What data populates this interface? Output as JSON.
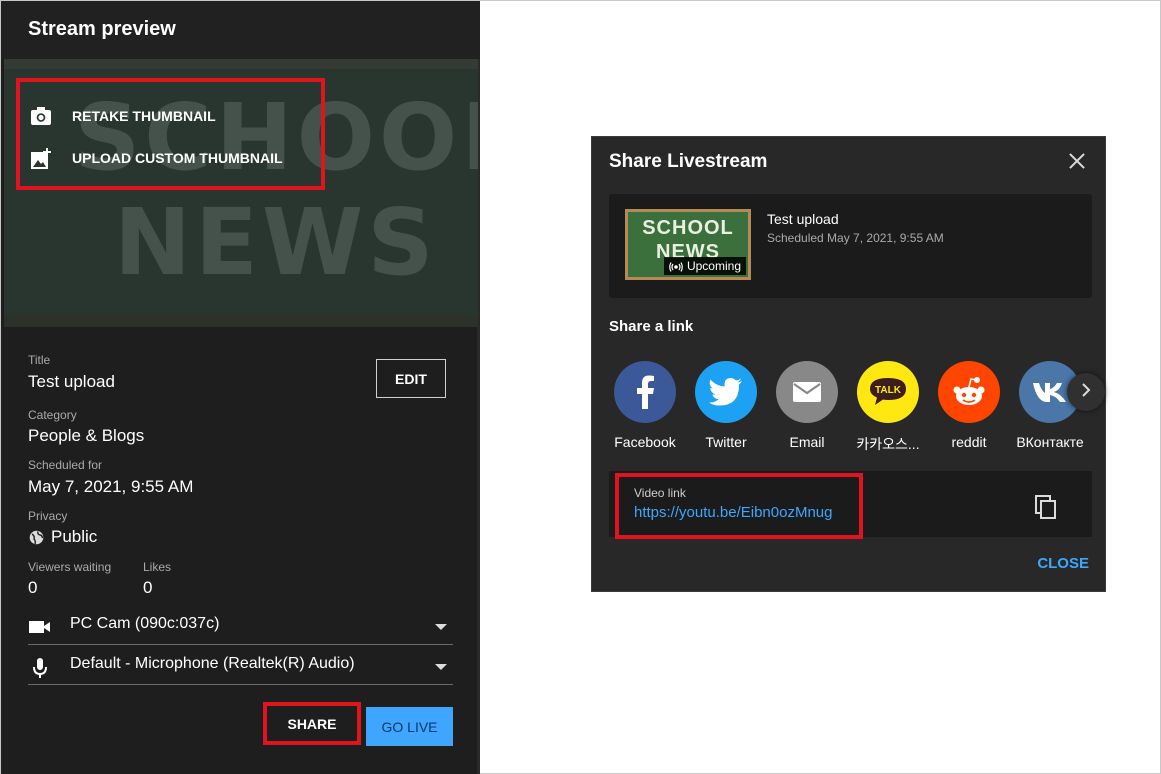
{
  "stream_preview": {
    "title": "Stream preview",
    "thumbnail_chalk_line1": "SCHOOL",
    "thumbnail_chalk_line2": "NEWS",
    "retake_thumbnail": "RETAKE THUMBNAIL",
    "upload_custom_thumbnail": "UPLOAD CUSTOM THUMBNAIL",
    "fields": {
      "title_label": "Title",
      "title_value": "Test upload",
      "category_label": "Category",
      "category_value": "People & Blogs",
      "scheduled_label": "Scheduled for",
      "scheduled_value": "May 7, 2021, 9:55 AM",
      "privacy_label": "Privacy",
      "privacy_value": "Public",
      "viewers_label": "Viewers waiting",
      "viewers_value": "0",
      "likes_label": "Likes",
      "likes_value": "0"
    },
    "edit_label": "EDIT",
    "camera": "PC Cam (090c:037c)",
    "microphone": "Default - Microphone (Realtek(R) Audio)",
    "share_label": "SHARE",
    "go_live_label": "GO LIVE"
  },
  "share_dialog": {
    "title": "Share Livestream",
    "video": {
      "thumb_line1": "SCHOOL",
      "thumb_line2": "NEWS",
      "badge": "Upcoming",
      "title": "Test upload",
      "scheduled": "Scheduled May 7, 2021, 9:55 AM"
    },
    "share_a_link": "Share a link",
    "socials": [
      {
        "label": "Facebook",
        "icon": "facebook-icon",
        "color": "#3b5998"
      },
      {
        "label": "Twitter",
        "icon": "twitter-icon",
        "color": "#1da1f2"
      },
      {
        "label": "Email",
        "icon": "email-icon",
        "color": "#888888"
      },
      {
        "label": "카카오스...",
        "icon": "kakaotalk-icon",
        "color": "#ffe812"
      },
      {
        "label": "reddit",
        "icon": "reddit-icon",
        "color": "#ff4500"
      },
      {
        "label": "ВКонтакте",
        "icon": "vk-icon",
        "color": "#4a76a8"
      }
    ],
    "video_link_label": "Video link",
    "video_link_url": "https://youtu.be/Eibn0ozMnug",
    "close_label": "CLOSE"
  },
  "colors": {
    "highlight_red": "#e0141e",
    "accent_blue": "#3ea6ff"
  }
}
